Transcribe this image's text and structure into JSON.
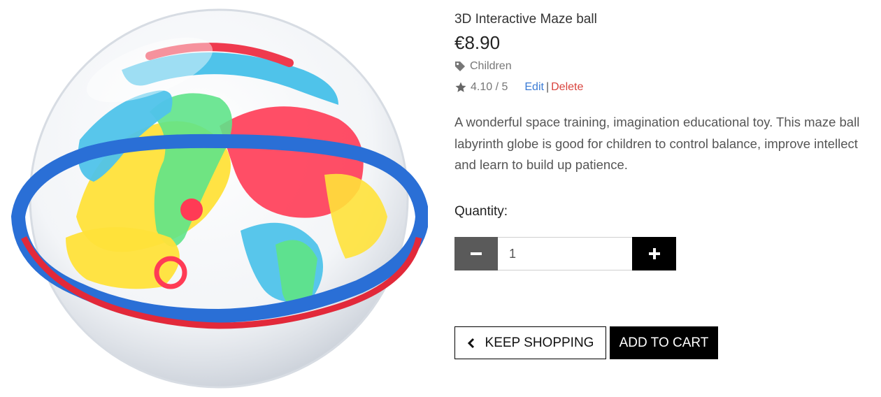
{
  "product": {
    "name": "3D Interactive Maze ball",
    "price": "€8.90",
    "category": "Children",
    "rating": "4.10 / 5",
    "edit_label": "Edit",
    "separator": "|",
    "delete_label": "Delete",
    "description": "A wonderful space training, imagination educational toy. This maze ball labyrinth globe is good for children to control balance, improve intellect and learn to build up patience.",
    "image_icon": "maze-ball-product-photo"
  },
  "quantity": {
    "label": "Quantity:",
    "value": "1",
    "minus_icon": "minus-icon",
    "plus_icon": "plus-icon"
  },
  "actions": {
    "keep_shopping_label": "KEEP SHOPPING",
    "keep_shopping_icon": "chevron-left-icon",
    "add_to_cart_label": "ADD TO CART"
  },
  "colors": {
    "link_blue": "#3a7bd5",
    "delete_red": "#d9433d",
    "minus_button": "#5a5a5a",
    "plus_button": "#000000",
    "primary_button": "#000000"
  }
}
